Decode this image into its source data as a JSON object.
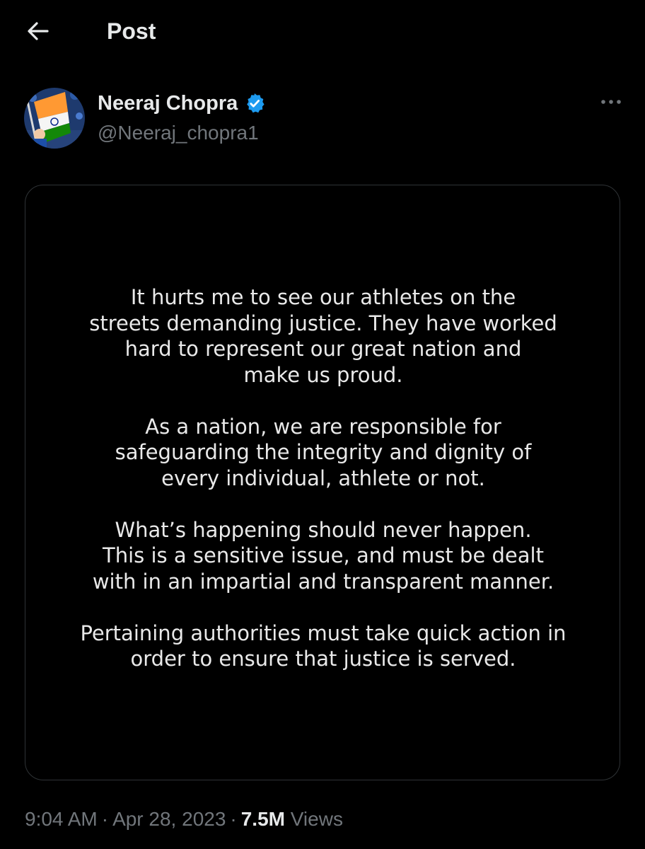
{
  "header": {
    "title": "Post",
    "back_icon": "arrow-left-icon"
  },
  "author": {
    "display_name": "Neeraj Chopra",
    "handle": "@Neeraj_chopra1",
    "verified": true,
    "verified_color": "#1d9bf0",
    "avatar_icon": "avatar-photo",
    "more_icon": "more-horizontal-icon"
  },
  "media": {
    "paragraphs": [
      "It hurts me to see our athletes on the\nstreets demanding justice. They have worked\nhard to represent our great nation and\nmake us proud.",
      "As a nation, we are responsible for\nsafeguarding the integrity and dignity of\nevery individual, athlete or not.",
      "What’s happening should never happen.\nThis is a sensitive issue, and must be dealt\nwith in an impartial and transparent manner.",
      "Pertaining authorities must take quick action in\norder to ensure that justice is served."
    ]
  },
  "meta": {
    "time": "9:04 AM",
    "separator": "·",
    "date": "Apr 28, 2023",
    "views_count": "7.5M",
    "views_label": "Views"
  },
  "colors": {
    "background": "#000000",
    "text_primary": "#e7e9ea",
    "text_secondary": "#71767b",
    "border": "#2f3336",
    "accent": "#1d9bf0"
  }
}
